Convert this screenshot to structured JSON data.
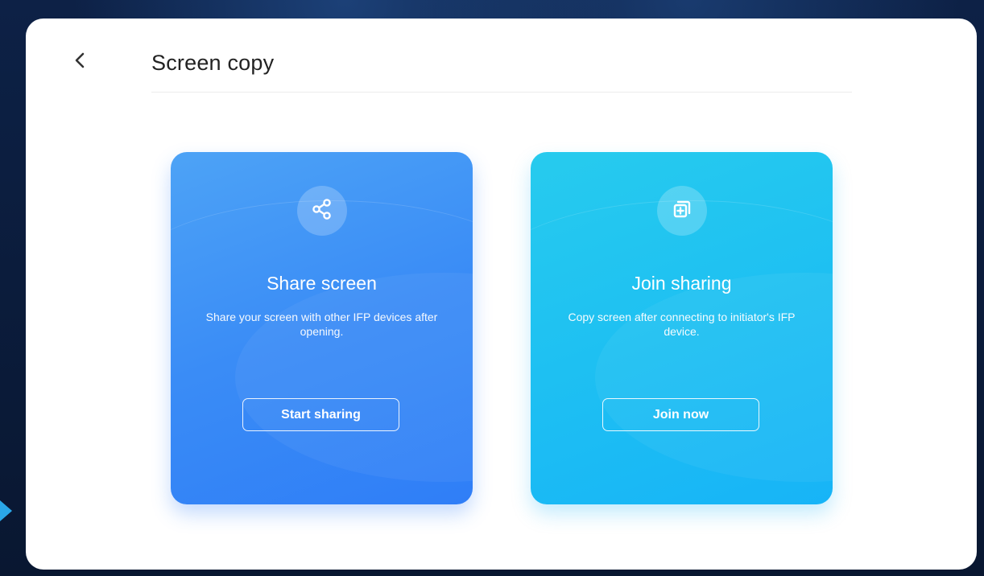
{
  "header": {
    "back_icon": "chevron-left-icon",
    "title": "Screen copy"
  },
  "cards": [
    {
      "icon": "share-icon",
      "title": "Share screen",
      "description": "Share your screen with other IFP devices after opening.",
      "button_label": "Start sharing",
      "color": "#3a8cf6"
    },
    {
      "icon": "copy-add-icon",
      "title": "Join sharing",
      "description": "Copy screen after connecting to initiator's IFP device.",
      "button_label": "Join now",
      "color": "#1ec0f2"
    }
  ],
  "colors": {
    "background": "#0b1c3a",
    "panel": "#ffffff",
    "side_arrow": "#2aa7e8",
    "title_text": "#222222"
  }
}
